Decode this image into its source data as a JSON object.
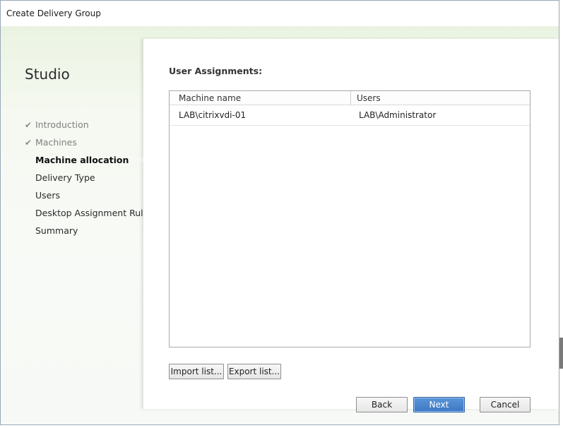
{
  "window": {
    "title": "Create Delivery Group"
  },
  "sidebar": {
    "brand": "Studio",
    "steps": [
      {
        "label": "Introduction",
        "state": "done"
      },
      {
        "label": "Machines",
        "state": "done"
      },
      {
        "label": "Machine allocation",
        "state": "active"
      },
      {
        "label": "Delivery Type",
        "state": "pending"
      },
      {
        "label": "Users",
        "state": "pending"
      },
      {
        "label": "Desktop Assignment Rules",
        "state": "pending"
      },
      {
        "label": "Summary",
        "state": "pending"
      }
    ],
    "check_glyph": "✔"
  },
  "main": {
    "section_title": "User Assignments:",
    "table": {
      "columns": [
        "Machine name",
        "Users"
      ],
      "rows": [
        [
          "LAB\\citrixvdi-01",
          "LAB\\Administrator"
        ]
      ]
    },
    "import_label": "Import list...",
    "export_label": "Export list..."
  },
  "footer": {
    "back_label": "Back",
    "next_label": "Next",
    "cancel_label": "Cancel"
  },
  "colors": {
    "accent": "#3d78c5",
    "wizard_bg": "#eaf3e2"
  }
}
